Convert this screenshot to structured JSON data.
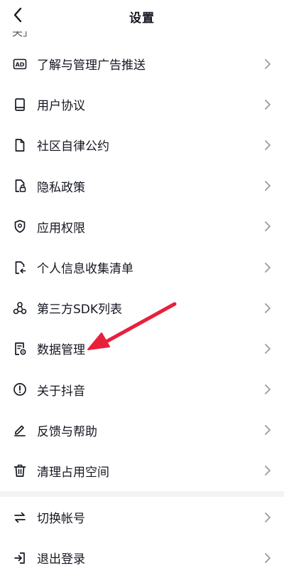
{
  "header": {
    "title": "设置"
  },
  "partial_text": "关」",
  "menu_group_main": [
    {
      "label": "了解与管理广告推送",
      "icon": "ad-icon"
    },
    {
      "label": "用户协议",
      "icon": "book-icon"
    },
    {
      "label": "社区自律公约",
      "icon": "document-icon"
    },
    {
      "label": "隐私政策",
      "icon": "privacy-lock-icon"
    },
    {
      "label": "应用权限",
      "icon": "shield-icon"
    },
    {
      "label": "个人信息收集清单",
      "icon": "file-arrow-icon"
    },
    {
      "label": "第三方SDK列表",
      "icon": "sdk-nodes-icon"
    },
    {
      "label": "数据管理",
      "icon": "data-manage-icon"
    },
    {
      "label": "关于抖音",
      "icon": "info-circle-icon"
    },
    {
      "label": "反馈与帮助",
      "icon": "pencil-icon"
    },
    {
      "label": "清理占用空间",
      "icon": "trash-icon"
    }
  ],
  "menu_group_account": [
    {
      "label": "切换帐号",
      "icon": "switch-arrows-icon"
    },
    {
      "label": "退出登录",
      "icon": "logout-icon"
    }
  ],
  "colors": {
    "text": "#161823",
    "chevron": "#9a9ba0",
    "divider": "#f3f3f4",
    "annotation_arrow": "#e8203a"
  }
}
